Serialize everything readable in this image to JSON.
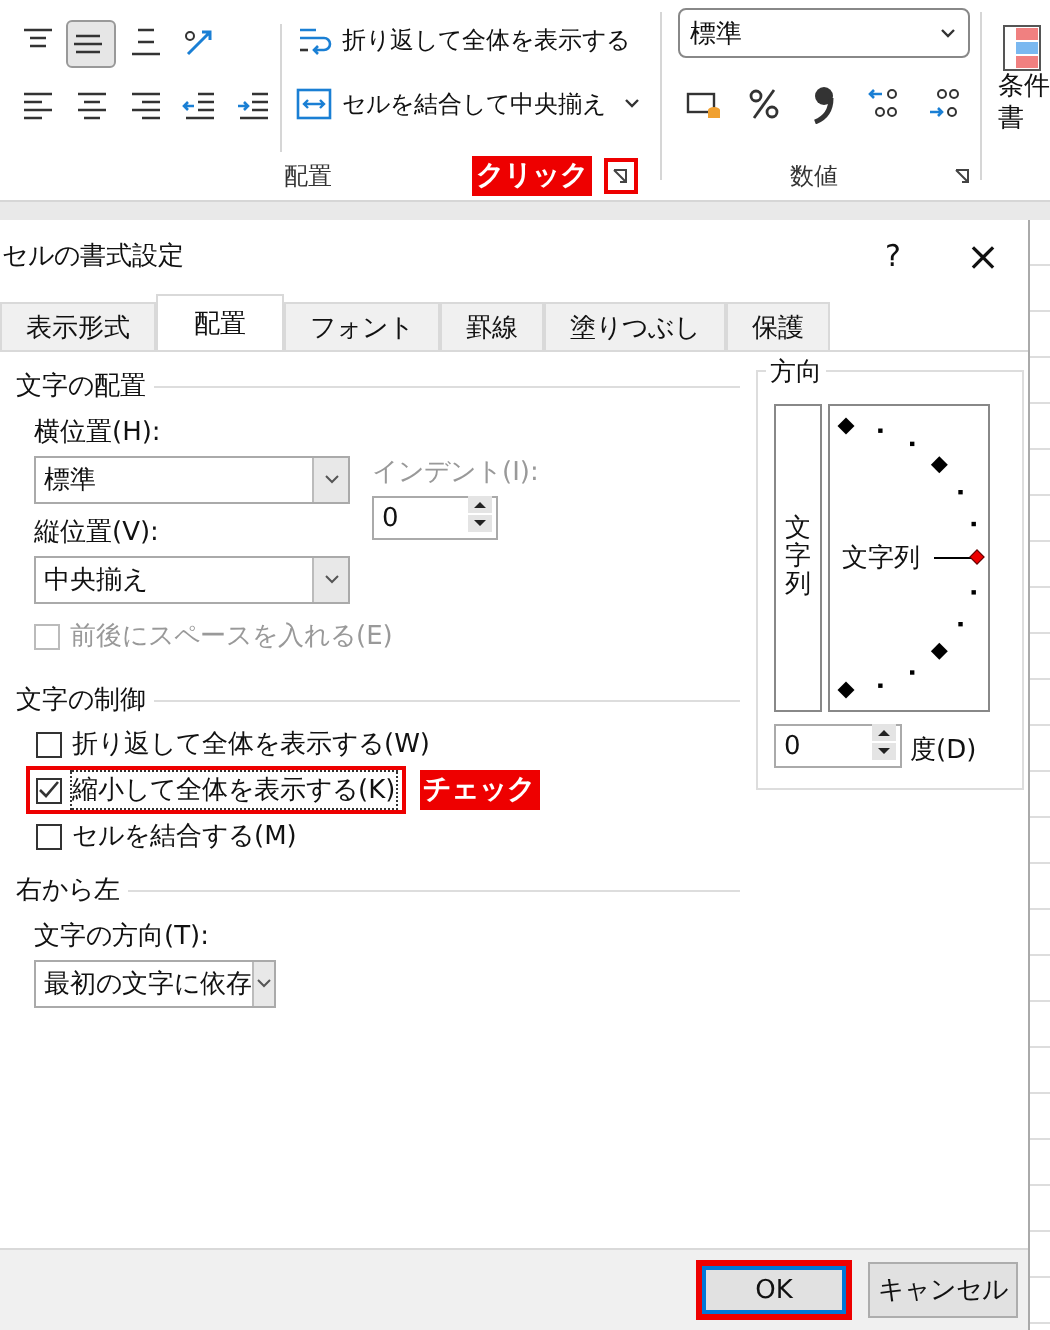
{
  "ribbon": {
    "alignment_group": {
      "label": "配置",
      "callout": "クリック",
      "launcher_highlighted": true,
      "rows": [
        [
          {
            "kind": "align-top",
            "selected": false
          },
          {
            "kind": "align-middle",
            "selected": true
          },
          {
            "kind": "align-bottom",
            "selected": false
          },
          {
            "kind": "orientation",
            "selected": false
          }
        ],
        [
          {
            "kind": "align-left",
            "selected": false
          },
          {
            "kind": "align-center",
            "selected": false
          },
          {
            "kind": "align-right",
            "selected": false
          },
          {
            "kind": "indent-decrease",
            "selected": false
          },
          {
            "kind": "indent-increase",
            "selected": false
          }
        ]
      ],
      "commands": [
        {
          "kind": "wrap",
          "label": "折り返して全体を表示する"
        },
        {
          "kind": "merge",
          "label": "セルを結合して中央揃え"
        }
      ]
    },
    "number_group": {
      "label": "数値",
      "format": "標準",
      "tools": [
        {
          "kind": "accounting"
        },
        {
          "kind": "percent"
        },
        {
          "kind": "comma"
        },
        {
          "kind": "decimal-increase"
        },
        {
          "kind": "decimal-decrease"
        }
      ]
    },
    "styles_group": {
      "label_lines": [
        "条件",
        "書"
      ]
    }
  },
  "dialog": {
    "title": "セルの書式設定",
    "help": "?",
    "close": "×",
    "tabs": [
      {
        "label": "表示形式",
        "selected": false
      },
      {
        "label": "配置",
        "selected": true
      },
      {
        "label": "フォント",
        "selected": false
      },
      {
        "label": "罫線",
        "selected": false
      },
      {
        "label": "塗りつぶし",
        "selected": false
      },
      {
        "label": "保護",
        "selected": false
      }
    ],
    "text_alignment": {
      "heading": "文字の配置",
      "horizontal": {
        "label": "横位置(H):",
        "value": "標準"
      },
      "vertical": {
        "label": "縦位置(V):",
        "value": "中央揃え"
      },
      "indent": {
        "label": "インデント(I):",
        "value": "0",
        "disabled": true
      },
      "distributed": {
        "label": "前後にスペースを入れる(E)",
        "checked": false,
        "disabled": true
      }
    },
    "text_control": {
      "heading": "文字の制御",
      "options": [
        {
          "label": "折り返して全体を表示する(W)",
          "checked": false,
          "highlighted": false
        },
        {
          "label": "縮小して全体を表示する(K)",
          "checked": true,
          "highlighted": true,
          "callout": "チェック"
        },
        {
          "label": "セルを結合する(M)",
          "checked": false,
          "highlighted": false
        }
      ]
    },
    "right_to_left": {
      "heading": "右から左",
      "direction": {
        "label": "文字の方向(T):",
        "value": "最初の文字に依存"
      }
    },
    "orientation": {
      "heading": "方向",
      "vertical_text": "文字列",
      "dial_text": "文字列",
      "degrees": {
        "value": "0",
        "label": "度(D)"
      }
    },
    "buttons": [
      {
        "label": "OK",
        "highlighted": true
      },
      {
        "label": "キャンセル",
        "highlighted": false
      }
    ]
  }
}
